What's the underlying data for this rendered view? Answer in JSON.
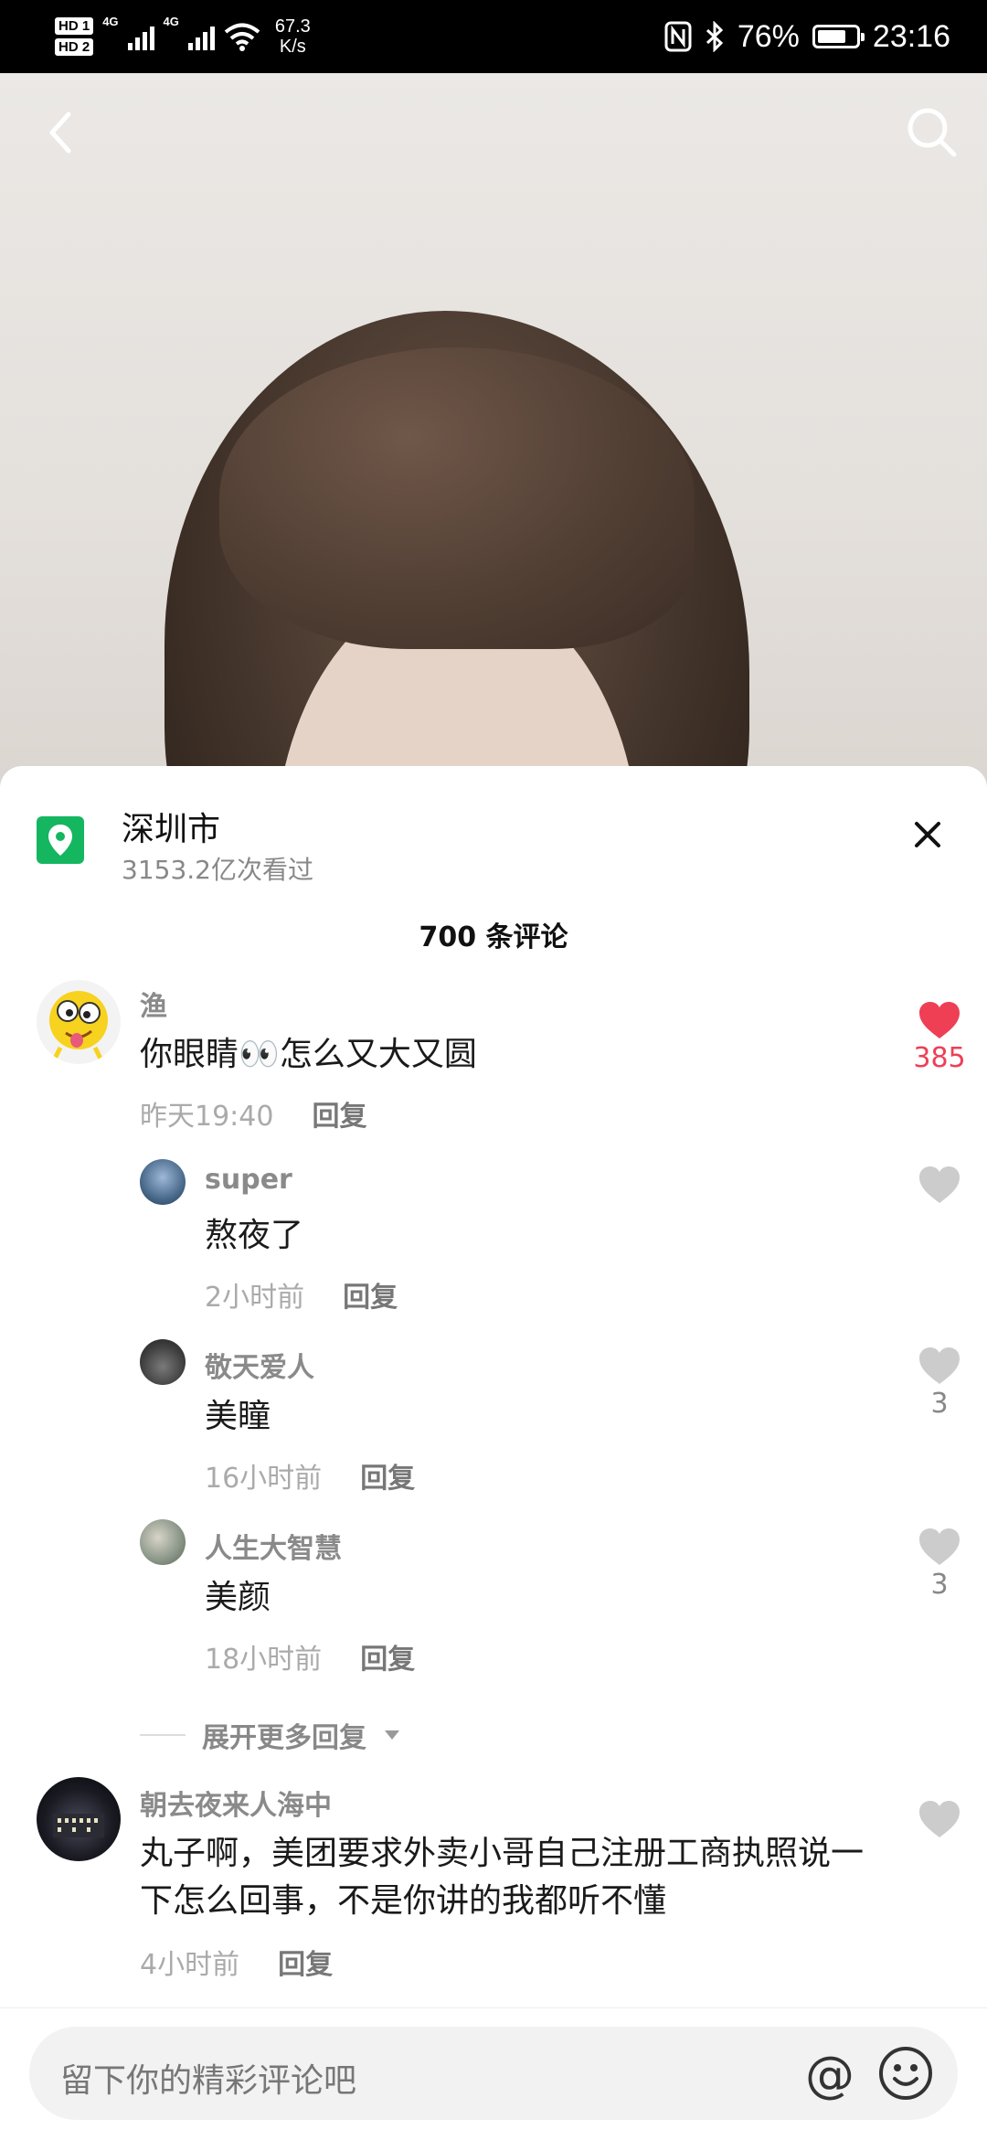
{
  "status_bar": {
    "hd1": "HD 1",
    "hd2": "HD 2",
    "net1": "4G",
    "net2": "4G",
    "speed_value": "67.3",
    "speed_unit": "K/s",
    "battery_text": "76%",
    "battery_level": 0.76,
    "time": "23:16"
  },
  "video": {
    "back_icon": "chevron-left-icon",
    "search_icon": "search-icon"
  },
  "location": {
    "name": "深圳市",
    "views": "3153.2亿次看过",
    "icon": "location-pin-icon",
    "color": "#15B660"
  },
  "comments_title": "700 条评论",
  "comments": [
    {
      "user": "渔",
      "text": "你眼睛👀怎么又大又圆",
      "time": "昨天19:40",
      "reply_label": "回复",
      "likes": "385",
      "liked": true
    },
    {
      "user": "super",
      "text": "熬夜了",
      "time": "2小时前",
      "reply_label": "回复",
      "likes": "",
      "liked": false
    },
    {
      "user": "敬天爱人",
      "text": "美瞳",
      "time": "16小时前",
      "reply_label": "回复",
      "likes": "3",
      "liked": false
    },
    {
      "user": "人生大智慧",
      "text": "美颜",
      "time": "18小时前",
      "reply_label": "回复",
      "likes": "3",
      "liked": false
    },
    {
      "user": "朝去夜来人海中",
      "text": "丸子啊，美团要求外卖小哥自己注册工商执照说一下怎么回事，不是你讲的我都听不懂",
      "time": "4小时前",
      "reply_label": "回复",
      "likes": "",
      "liked": false
    }
  ],
  "expand_more": "展开更多回复",
  "input": {
    "placeholder": "留下你的精彩评论吧",
    "at_symbol": "@"
  },
  "colors": {
    "like_active": "#EE3F55",
    "like_inactive": "#CCCCCC"
  }
}
